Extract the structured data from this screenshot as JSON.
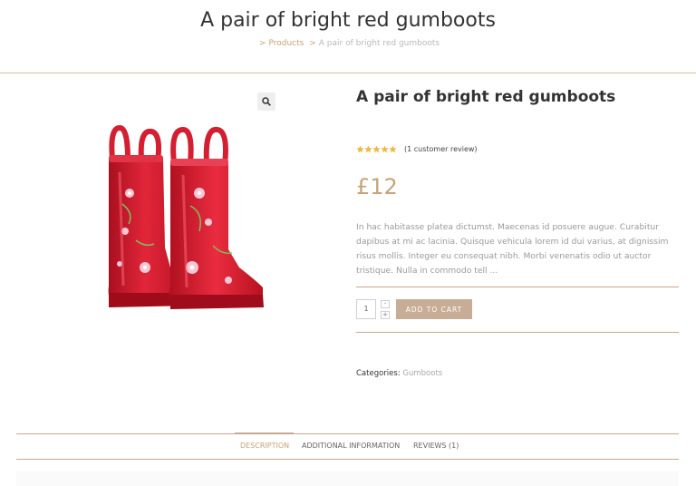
{
  "header": {
    "title": "A pair of bright red gumboots",
    "breadcrumb": {
      "separator": ">",
      "items": [
        "Products",
        "A pair of bright red gumboots"
      ]
    }
  },
  "gallery": {
    "image_alt": "Red gumboots with floral pattern",
    "zoom_icon": "search-icon"
  },
  "product": {
    "title": "A pair of bright red gumboots",
    "rating": {
      "stars": 5,
      "max": 5,
      "review_text": "(1 customer review)"
    },
    "price": "£12",
    "short_description": "In hac habitasse platea dictumst. Maecenas id posuere augue. Curabitur dapibus at mi ac lacinia. Quisque vehicula lorem id dui varius, at dignissim risus mollis. Integer eu consequat nibh. Morbi venenatis odio ut auctor tristique. Nulla in commodo tell ...",
    "quantity": "1",
    "qty_minus": "-",
    "qty_plus": "+",
    "add_to_cart_label": "ADD TO CART",
    "categories_label": "Categories:",
    "category": "Gumboots"
  },
  "tabs": [
    {
      "label": "DESCRIPTION",
      "active": true
    },
    {
      "label": "ADDITIONAL INFORMATION",
      "active": false
    },
    {
      "label": "REVIEWS (1)",
      "active": false
    }
  ],
  "colors": {
    "accent": "#c8a27a",
    "button": "#c8ad96",
    "star": "#e8b94a",
    "boot_red": "#d7192f"
  }
}
